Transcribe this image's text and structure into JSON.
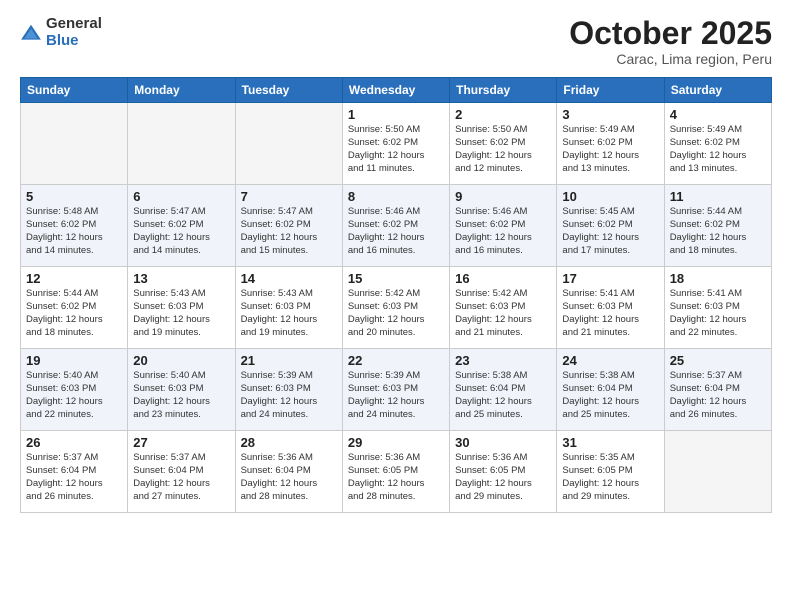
{
  "logo": {
    "general": "General",
    "blue": "Blue"
  },
  "title": "October 2025",
  "subtitle": "Carac, Lima region, Peru",
  "days_of_week": [
    "Sunday",
    "Monday",
    "Tuesday",
    "Wednesday",
    "Thursday",
    "Friday",
    "Saturday"
  ],
  "weeks": [
    [
      {
        "day": "",
        "info": ""
      },
      {
        "day": "",
        "info": ""
      },
      {
        "day": "",
        "info": ""
      },
      {
        "day": "1",
        "info": "Sunrise: 5:50 AM\nSunset: 6:02 PM\nDaylight: 12 hours\nand 11 minutes."
      },
      {
        "day": "2",
        "info": "Sunrise: 5:50 AM\nSunset: 6:02 PM\nDaylight: 12 hours\nand 12 minutes."
      },
      {
        "day": "3",
        "info": "Sunrise: 5:49 AM\nSunset: 6:02 PM\nDaylight: 12 hours\nand 13 minutes."
      },
      {
        "day": "4",
        "info": "Sunrise: 5:49 AM\nSunset: 6:02 PM\nDaylight: 12 hours\nand 13 minutes."
      }
    ],
    [
      {
        "day": "5",
        "info": "Sunrise: 5:48 AM\nSunset: 6:02 PM\nDaylight: 12 hours\nand 14 minutes."
      },
      {
        "day": "6",
        "info": "Sunrise: 5:47 AM\nSunset: 6:02 PM\nDaylight: 12 hours\nand 14 minutes."
      },
      {
        "day": "7",
        "info": "Sunrise: 5:47 AM\nSunset: 6:02 PM\nDaylight: 12 hours\nand 15 minutes."
      },
      {
        "day": "8",
        "info": "Sunrise: 5:46 AM\nSunset: 6:02 PM\nDaylight: 12 hours\nand 16 minutes."
      },
      {
        "day": "9",
        "info": "Sunrise: 5:46 AM\nSunset: 6:02 PM\nDaylight: 12 hours\nand 16 minutes."
      },
      {
        "day": "10",
        "info": "Sunrise: 5:45 AM\nSunset: 6:02 PM\nDaylight: 12 hours\nand 17 minutes."
      },
      {
        "day": "11",
        "info": "Sunrise: 5:44 AM\nSunset: 6:02 PM\nDaylight: 12 hours\nand 18 minutes."
      }
    ],
    [
      {
        "day": "12",
        "info": "Sunrise: 5:44 AM\nSunset: 6:02 PM\nDaylight: 12 hours\nand 18 minutes."
      },
      {
        "day": "13",
        "info": "Sunrise: 5:43 AM\nSunset: 6:03 PM\nDaylight: 12 hours\nand 19 minutes."
      },
      {
        "day": "14",
        "info": "Sunrise: 5:43 AM\nSunset: 6:03 PM\nDaylight: 12 hours\nand 19 minutes."
      },
      {
        "day": "15",
        "info": "Sunrise: 5:42 AM\nSunset: 6:03 PM\nDaylight: 12 hours\nand 20 minutes."
      },
      {
        "day": "16",
        "info": "Sunrise: 5:42 AM\nSunset: 6:03 PM\nDaylight: 12 hours\nand 21 minutes."
      },
      {
        "day": "17",
        "info": "Sunrise: 5:41 AM\nSunset: 6:03 PM\nDaylight: 12 hours\nand 21 minutes."
      },
      {
        "day": "18",
        "info": "Sunrise: 5:41 AM\nSunset: 6:03 PM\nDaylight: 12 hours\nand 22 minutes."
      }
    ],
    [
      {
        "day": "19",
        "info": "Sunrise: 5:40 AM\nSunset: 6:03 PM\nDaylight: 12 hours\nand 22 minutes."
      },
      {
        "day": "20",
        "info": "Sunrise: 5:40 AM\nSunset: 6:03 PM\nDaylight: 12 hours\nand 23 minutes."
      },
      {
        "day": "21",
        "info": "Sunrise: 5:39 AM\nSunset: 6:03 PM\nDaylight: 12 hours\nand 24 minutes."
      },
      {
        "day": "22",
        "info": "Sunrise: 5:39 AM\nSunset: 6:03 PM\nDaylight: 12 hours\nand 24 minutes."
      },
      {
        "day": "23",
        "info": "Sunrise: 5:38 AM\nSunset: 6:04 PM\nDaylight: 12 hours\nand 25 minutes."
      },
      {
        "day": "24",
        "info": "Sunrise: 5:38 AM\nSunset: 6:04 PM\nDaylight: 12 hours\nand 25 minutes."
      },
      {
        "day": "25",
        "info": "Sunrise: 5:37 AM\nSunset: 6:04 PM\nDaylight: 12 hours\nand 26 minutes."
      }
    ],
    [
      {
        "day": "26",
        "info": "Sunrise: 5:37 AM\nSunset: 6:04 PM\nDaylight: 12 hours\nand 26 minutes."
      },
      {
        "day": "27",
        "info": "Sunrise: 5:37 AM\nSunset: 6:04 PM\nDaylight: 12 hours\nand 27 minutes."
      },
      {
        "day": "28",
        "info": "Sunrise: 5:36 AM\nSunset: 6:04 PM\nDaylight: 12 hours\nand 28 minutes."
      },
      {
        "day": "29",
        "info": "Sunrise: 5:36 AM\nSunset: 6:05 PM\nDaylight: 12 hours\nand 28 minutes."
      },
      {
        "day": "30",
        "info": "Sunrise: 5:36 AM\nSunset: 6:05 PM\nDaylight: 12 hours\nand 29 minutes."
      },
      {
        "day": "31",
        "info": "Sunrise: 5:35 AM\nSunset: 6:05 PM\nDaylight: 12 hours\nand 29 minutes."
      },
      {
        "day": "",
        "info": ""
      }
    ]
  ]
}
